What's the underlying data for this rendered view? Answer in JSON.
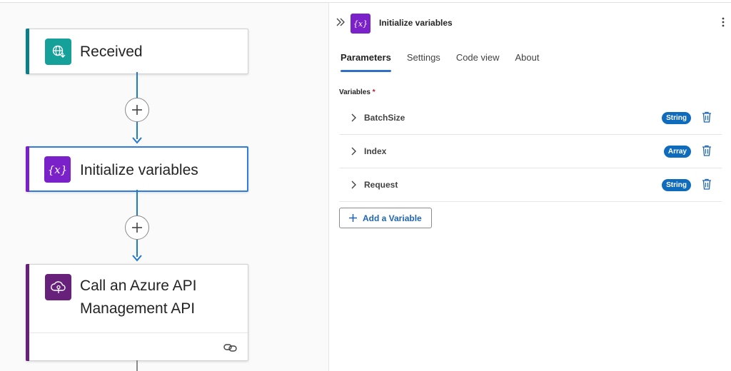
{
  "canvas": {
    "cards": {
      "received": {
        "title": "Received",
        "icon": "globe-icon"
      },
      "init": {
        "title": "Initialize variables",
        "icon": "variable-icon"
      },
      "azure": {
        "title": "Call an Azure API Management API",
        "icon": "cloud-api-icon"
      }
    },
    "colors": {
      "connector": "#1f78d1",
      "received_accent": "#15a19a",
      "variable_accent": "#7a21c9",
      "azure_accent": "#68217a",
      "selected_border": "#2f7fd8"
    }
  },
  "panel": {
    "title": "Initialize variables",
    "icon_text": "{x}",
    "tabs": [
      {
        "label": "Parameters",
        "active": true
      },
      {
        "label": "Settings",
        "active": false
      },
      {
        "label": "Code view",
        "active": false
      },
      {
        "label": "About",
        "active": false
      }
    ],
    "variables_label": "Variables",
    "required_mark": "*",
    "variables": [
      {
        "name": "BatchSize",
        "type": "String"
      },
      {
        "name": "Index",
        "type": "Array"
      },
      {
        "name": "Request",
        "type": "String"
      }
    ],
    "add_button_label": "Add a Variable",
    "colors": {
      "badge": "#0f6cbd",
      "active_tab": "#2f6ec9",
      "add_button_text": "#1f65b5",
      "required": "#c50f1f"
    }
  }
}
